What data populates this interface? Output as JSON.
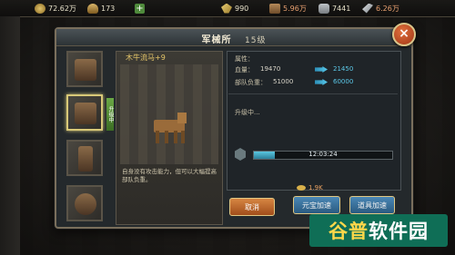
{
  "topbar": {
    "resources": [
      {
        "name": "coin-icon",
        "value": "72.62万"
      },
      {
        "name": "bowl-icon",
        "value": "173"
      },
      {
        "name": "wheat-icon",
        "value": "990"
      },
      {
        "name": "wood-icon",
        "value": "5.96万"
      },
      {
        "name": "stone-icon",
        "value": "7441"
      },
      {
        "name": "iron-icon",
        "value": "6.26万"
      }
    ],
    "plus_label": "+"
  },
  "dialog": {
    "title": "军械所",
    "level": "15级",
    "close_label": "×"
  },
  "preview": {
    "item_name": "木牛流马+9",
    "description": "自身没有攻击能力，但可以大幅提高部队负重。"
  },
  "thumbs": {
    "badge": "升级中"
  },
  "info": {
    "attr_title": "属性：",
    "rows": [
      {
        "label": "血量：",
        "current": "19470",
        "next": "21450"
      },
      {
        "label": "部队负重：",
        "current": "51000",
        "next": "60000"
      }
    ],
    "upgrading": "升级中...",
    "progress_fraction": 0.15,
    "time_remaining": "12:03:24"
  },
  "buttons": {
    "cancel": "取消",
    "free": "元宝加速",
    "speed": "道具加速",
    "cost": "1.9K"
  },
  "watermark": {
    "text_a": "谷普",
    "text_b": "软件园"
  },
  "colors": {
    "accent_up": "#5cc8e8",
    "title_gold": "#e8c86a",
    "cancel": "#c8692e"
  }
}
